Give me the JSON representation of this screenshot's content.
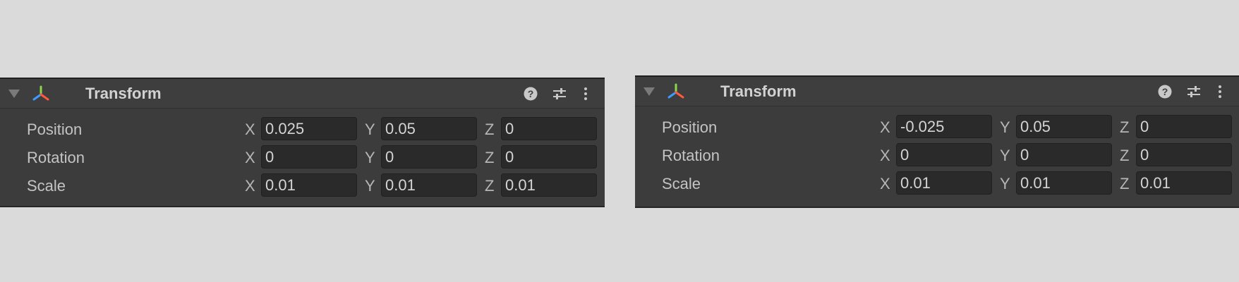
{
  "panels": [
    {
      "title": "Transform",
      "rows": [
        {
          "label": "Position",
          "x_axis": "X",
          "x": "0.025",
          "y_axis": "Y",
          "y": "0.05",
          "z_axis": "Z",
          "z": "0"
        },
        {
          "label": "Rotation",
          "x_axis": "X",
          "x": "0",
          "y_axis": "Y",
          "y": "0",
          "z_axis": "Z",
          "z": "0"
        },
        {
          "label": "Scale",
          "x_axis": "X",
          "x": "0.01",
          "y_axis": "Y",
          "y": "0.01",
          "z_axis": "Z",
          "z": "0.01"
        }
      ]
    },
    {
      "title": "Transform",
      "rows": [
        {
          "label": "Position",
          "x_axis": "X",
          "x": "-0.025",
          "y_axis": "Y",
          "y": "0.05",
          "z_axis": "Z",
          "z": "0"
        },
        {
          "label": "Rotation",
          "x_axis": "X",
          "x": "0",
          "y_axis": "Y",
          "y": "0",
          "z_axis": "Z",
          "z": "0"
        },
        {
          "label": "Scale",
          "x_axis": "X",
          "x": "0.01",
          "y_axis": "Y",
          "y": "0.01",
          "z_axis": "Z",
          "z": "0.01"
        }
      ]
    }
  ],
  "icons": {
    "foldout": "triangle-down-icon",
    "component": "transform-axes-icon",
    "help": "help-icon",
    "presets": "sliders-icon",
    "menu": "kebab-menu-icon"
  },
  "colors": {
    "canvas_background": "#dadada",
    "panel_background": "#3c3c3c",
    "field_background": "#2a2a2a",
    "axis_x": "#ff5a3c",
    "axis_y": "#8bd64a",
    "axis_z": "#3c9cff"
  }
}
